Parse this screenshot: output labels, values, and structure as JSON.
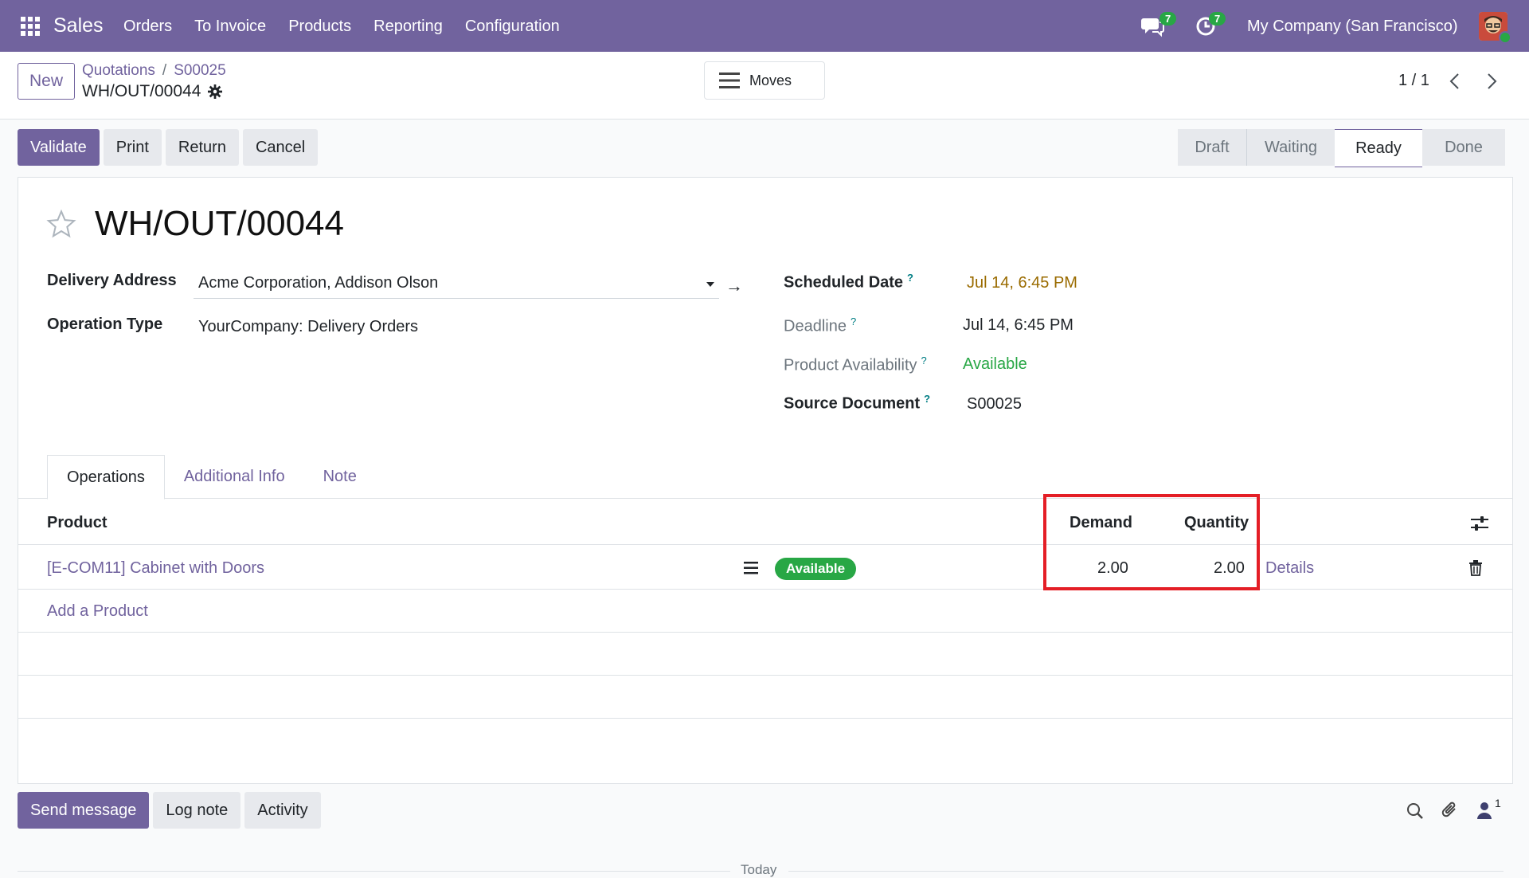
{
  "navbar": {
    "app_name": "Sales",
    "menu": [
      "Orders",
      "To Invoice",
      "Products",
      "Reporting",
      "Configuration"
    ],
    "messages_count": "7",
    "activities_count": "7",
    "company": "My Company (San Francisco)"
  },
  "control": {
    "new_label": "New",
    "breadcrumb": [
      "Quotations",
      "S00025"
    ],
    "record_title": "WH/OUT/00044",
    "moves_label": "Moves",
    "pager": "1 / 1"
  },
  "actions": {
    "validate": "Validate",
    "print": "Print",
    "return": "Return",
    "cancel": "Cancel"
  },
  "status": {
    "stages": [
      "Draft",
      "Waiting",
      "Ready",
      "Done"
    ],
    "current": "Ready"
  },
  "form": {
    "name": "WH/OUT/00044",
    "delivery_address_label": "Delivery Address",
    "delivery_address": "Acme Corporation, Addison Olson",
    "operation_type_label": "Operation Type",
    "operation_type": "YourCompany: Delivery Orders",
    "scheduled_date_label": "Scheduled Date",
    "scheduled_date": "Jul 14, 6:45 PM",
    "deadline_label": "Deadline",
    "deadline": "Jul 14, 6:45 PM",
    "availability_label": "Product Availability",
    "availability": "Available",
    "source_doc_label": "Source Document",
    "source_doc": "S00025",
    "help_mark": "?"
  },
  "tabs": [
    "Operations",
    "Additional Info",
    "Note"
  ],
  "table": {
    "headers": {
      "product": "Product",
      "demand": "Demand",
      "quantity": "Quantity"
    },
    "rows": [
      {
        "product": "[E-COM11] Cabinet with Doors",
        "status": "Available",
        "demand": "2.00",
        "quantity": "2.00",
        "details": "Details"
      }
    ],
    "add_product": "Add a Product"
  },
  "chatter": {
    "send_message": "Send message",
    "log_note": "Log note",
    "activity": "Activity",
    "followers_count": "1",
    "today": "Today"
  },
  "colors": {
    "brand": "#71639e",
    "success": "#28a745",
    "highlight": "#e41e26",
    "date_warning": "#9a6b00"
  }
}
